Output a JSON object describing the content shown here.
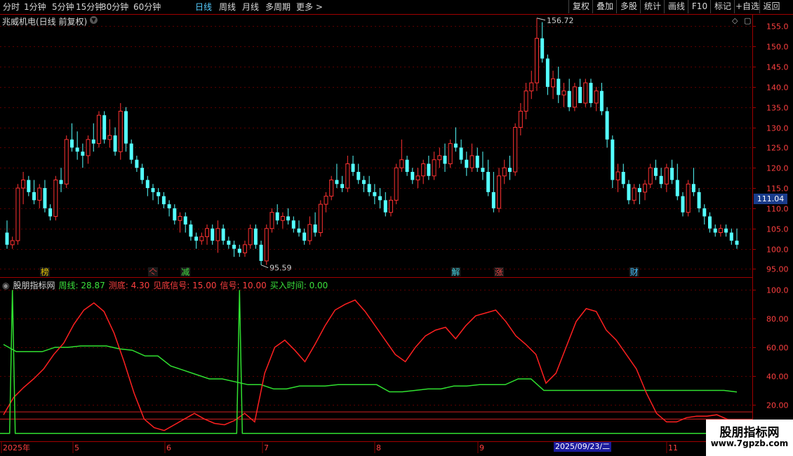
{
  "toolbar": {
    "periods": [
      "分时",
      "1分钟",
      "5分钟",
      "15分钟",
      "30分钟",
      "60分钟",
      "日线",
      "周线",
      "月线",
      "多周期",
      "更多 >"
    ],
    "active_period": "日线",
    "right_buttons": [
      "复权",
      "叠加",
      "多股",
      "统计",
      "画线",
      "F10",
      "标记",
      "+自选",
      "返回"
    ]
  },
  "chart": {
    "title": "兆威机电(日线 前复权)",
    "current_price": "111.04",
    "high_label": "156.72",
    "low_label": "95.59",
    "y_ticks": [
      "155.0",
      "150.0",
      "145.0",
      "140.0",
      "135.0",
      "130.0",
      "125.0",
      "120.0",
      "115.0",
      "110.0",
      "105.0",
      "100.0",
      "95.00"
    ],
    "markers": [
      {
        "text": "榜",
        "color": "#e0c000"
      },
      {
        "text": "亽",
        "color": "#e04040"
      },
      {
        "text": "减",
        "color": "#40e040"
      },
      {
        "text": "解",
        "color": "#40d0e0"
      },
      {
        "text": "涨",
        "color": "#e04040"
      },
      {
        "text": "财",
        "color": "#40c0ff"
      }
    ]
  },
  "indicator": {
    "name": "股朋指标网",
    "items": [
      {
        "text": "周线: 28.87",
        "color": "#3ce03c"
      },
      {
        "text": "测底: 4.30",
        "color": "#ff4040"
      },
      {
        "text": "见底信号: 15.00",
        "color": "#ff4040"
      },
      {
        "text": "信号: 10.00",
        "color": "#ff4040"
      },
      {
        "text": "买入时间: 0.00",
        "color": "#3ce03c"
      }
    ],
    "y_ticks": [
      "100.0",
      "80.00",
      "60.00",
      "40.00",
      "20.00"
    ]
  },
  "x_axis": {
    "labels": [
      "2025年",
      "5",
      "6",
      "7",
      "8",
      "9",
      "11"
    ],
    "selected_date": "2025/09/23/二"
  },
  "watermark": {
    "line1": "股朋指标网",
    "line2": "www.7gpzb.com"
  },
  "colors": {
    "up": "#ff3232",
    "down": "#54ffff",
    "panel_border": "#a00000",
    "grid": "#5a0000",
    "zhou": "#30e030",
    "ce": "#ff2020"
  },
  "chart_data": [
    {
      "type": "candlestick",
      "title": "兆威机电(日线 前复权)",
      "ylim": [
        93,
        158
      ],
      "ohlc": [
        [
          104,
          107,
          100,
          101
        ],
        [
          101,
          103,
          100,
          102
        ],
        [
          102,
          116,
          101,
          115
        ],
        [
          115,
          119,
          111,
          117
        ],
        [
          117,
          118,
          113,
          114
        ],
        [
          114,
          117,
          111,
          112
        ],
        [
          112,
          116,
          110,
          115
        ],
        [
          115,
          117,
          109,
          110
        ],
        [
          110,
          111,
          107,
          108
        ],
        [
          108,
          118,
          107,
          117
        ],
        [
          117,
          120,
          114,
          116
        ],
        [
          116,
          128,
          115,
          127
        ],
        [
          127,
          131,
          124,
          125
        ],
        [
          125,
          129,
          122,
          124
        ],
        [
          124,
          126,
          120,
          123
        ],
        [
          123,
          128,
          121,
          127
        ],
        [
          127,
          131,
          124,
          126
        ],
        [
          126,
          134,
          125,
          133
        ],
        [
          133,
          134,
          126,
          127
        ],
        [
          127,
          132,
          125,
          128
        ],
        [
          128,
          130,
          123,
          124
        ],
        [
          124,
          136,
          122,
          134
        ],
        [
          134,
          135,
          124,
          126
        ],
        [
          126,
          127,
          121,
          122
        ],
        [
          122,
          123,
          119,
          120
        ],
        [
          120,
          121,
          116,
          117
        ],
        [
          117,
          118,
          113,
          115
        ],
        [
          115,
          116,
          112,
          114
        ],
        [
          114,
          115,
          111,
          113
        ],
        [
          113,
          114,
          110,
          111
        ],
        [
          111,
          112,
          108,
          110
        ],
        [
          110,
          111,
          106,
          107
        ],
        [
          107,
          109,
          104,
          108
        ],
        [
          108,
          109,
          104,
          106
        ],
        [
          106,
          107,
          102,
          103
        ],
        [
          103,
          104,
          100,
          102
        ],
        [
          102,
          104,
          101,
          103
        ],
        [
          103,
          106,
          101,
          105
        ],
        [
          105,
          106,
          101,
          102
        ],
        [
          102,
          107,
          99,
          105
        ],
        [
          105,
          106,
          101,
          102
        ],
        [
          102,
          103,
          100,
          101
        ],
        [
          101,
          102,
          98,
          100
        ],
        [
          100,
          101,
          98,
          99
        ],
        [
          99,
          102,
          98,
          101
        ],
        [
          101,
          106,
          100,
          105
        ],
        [
          105,
          106,
          100,
          101
        ],
        [
          101,
          102,
          96,
          97
        ],
        [
          97,
          106,
          96,
          105
        ],
        [
          105,
          110,
          104,
          109
        ],
        [
          109,
          111,
          106,
          107
        ],
        [
          107,
          109,
          105,
          108
        ],
        [
          108,
          110,
          106,
          107
        ],
        [
          107,
          108,
          104,
          105
        ],
        [
          105,
          107,
          103,
          104
        ],
        [
          104,
          105,
          101,
          102
        ],
        [
          102,
          108,
          101,
          106
        ],
        [
          106,
          109,
          103,
          104
        ],
        [
          104,
          112,
          103,
          111
        ],
        [
          111,
          114,
          109,
          113
        ],
        [
          113,
          118,
          112,
          117
        ],
        [
          117,
          121,
          115,
          116
        ],
        [
          116,
          118,
          114,
          115
        ],
        [
          115,
          123,
          114,
          121
        ],
        [
          121,
          123,
          118,
          119
        ],
        [
          119,
          121,
          116,
          117
        ],
        [
          117,
          118,
          114,
          116
        ],
        [
          116,
          118,
          113,
          114
        ],
        [
          114,
          116,
          111,
          113
        ],
        [
          113,
          115,
          110,
          112
        ],
        [
          112,
          114,
          108,
          109
        ],
        [
          109,
          113,
          108,
          112
        ],
        [
          112,
          121,
          111,
          120
        ],
        [
          120,
          127,
          119,
          122
        ],
        [
          122,
          123,
          118,
          119
        ],
        [
          119,
          120,
          116,
          117
        ],
        [
          117,
          120,
          115,
          118
        ],
        [
          118,
          122,
          116,
          121
        ],
        [
          121,
          123,
          117,
          118
        ],
        [
          118,
          124,
          117,
          122
        ],
        [
          122,
          125,
          120,
          123
        ],
        [
          123,
          126,
          119,
          121
        ],
        [
          121,
          127,
          120,
          126
        ],
        [
          126,
          130,
          124,
          125
        ],
        [
          125,
          127,
          121,
          122
        ],
        [
          122,
          124,
          118,
          120
        ],
        [
          120,
          126,
          119,
          123
        ],
        [
          123,
          125,
          119,
          120
        ],
        [
          120,
          124,
          117,
          119
        ],
        [
          119,
          122,
          113,
          114
        ],
        [
          114,
          119,
          109,
          110
        ],
        [
          110,
          120,
          109,
          118
        ],
        [
          118,
          122,
          116,
          120
        ],
        [
          120,
          123,
          117,
          119
        ],
        [
          119,
          131,
          118,
          130
        ],
        [
          130,
          136,
          128,
          134
        ],
        [
          134,
          141,
          132,
          139
        ],
        [
          139,
          144,
          137,
          141
        ],
        [
          141,
          157,
          139,
          152
        ],
        [
          152,
          156,
          146,
          147
        ],
        [
          147,
          148,
          138,
          140
        ],
        [
          140,
          144,
          137,
          142
        ],
        [
          142,
          145,
          136,
          138
        ],
        [
          138,
          141,
          135,
          139
        ],
        [
          139,
          142,
          134,
          135
        ],
        [
          135,
          141,
          134,
          140
        ],
        [
          140,
          142,
          136,
          136
        ],
        [
          136,
          142,
          135,
          141
        ],
        [
          141,
          142,
          135,
          136
        ],
        [
          136,
          140,
          134,
          139
        ],
        [
          139,
          141,
          133,
          134
        ],
        [
          134,
          135,
          125,
          127
        ],
        [
          127,
          128,
          115,
          117
        ],
        [
          117,
          121,
          114,
          119
        ],
        [
          119,
          121,
          115,
          116
        ],
        [
          116,
          117,
          111,
          112
        ],
        [
          112,
          116,
          111,
          115
        ],
        [
          115,
          116,
          111,
          114
        ],
        [
          114,
          117,
          112,
          116
        ],
        [
          116,
          121,
          115,
          120
        ],
        [
          120,
          122,
          117,
          118
        ],
        [
          118,
          120,
          115,
          116
        ],
        [
          116,
          121,
          114,
          120
        ],
        [
          120,
          122,
          116,
          117
        ],
        [
          117,
          121,
          112,
          113
        ],
        [
          113,
          114,
          108,
          109
        ],
        [
          109,
          117,
          108,
          116
        ],
        [
          116,
          120,
          113,
          114
        ],
        [
          114,
          115,
          109,
          110
        ],
        [
          110,
          111,
          106,
          108
        ],
        [
          108,
          109,
          104,
          105
        ],
        [
          105,
          106,
          103,
          104
        ],
        [
          104,
          106,
          103,
          105
        ],
        [
          105,
          106,
          103,
          104
        ],
        [
          104,
          105,
          101,
          102
        ],
        [
          102,
          105,
          100,
          101
        ]
      ]
    },
    {
      "type": "line",
      "ylim": [
        0,
        100
      ],
      "series": [
        {
          "name": "周线",
          "values": [
            62,
            57,
            57,
            57,
            60,
            60,
            61,
            61,
            61,
            59,
            58,
            54,
            54,
            47,
            44,
            41,
            38,
            38,
            36,
            34,
            34,
            31,
            31,
            33,
            33,
            33,
            34,
            34,
            34,
            34,
            29,
            29,
            30,
            31,
            31,
            33,
            33,
            34,
            34,
            34,
            38,
            38,
            30,
            30,
            30,
            30,
            30,
            30,
            30,
            30,
            30,
            30,
            30,
            30,
            30,
            30,
            30,
            28.9
          ]
        },
        {
          "name": "测底",
          "values": [
            13,
            25,
            32,
            38,
            45,
            55,
            63,
            76,
            86,
            91,
            85,
            70,
            50,
            28,
            10,
            4,
            2,
            6,
            10,
            14,
            10,
            7,
            6,
            9,
            14,
            8,
            42,
            60,
            65,
            58,
            50,
            62,
            75,
            86,
            90,
            93,
            85,
            75,
            65,
            55,
            50,
            60,
            68,
            72,
            74,
            66,
            75,
            82,
            84,
            86,
            78,
            68,
            62,
            55,
            35,
            42,
            60,
            78,
            87,
            85,
            72,
            65,
            55,
            45,
            28,
            14,
            8,
            8,
            11,
            12,
            12,
            13,
            10,
            4.3
          ]
        }
      ],
      "signal_spikes": [
        1,
        43,
        149,
        155
      ]
    }
  ]
}
